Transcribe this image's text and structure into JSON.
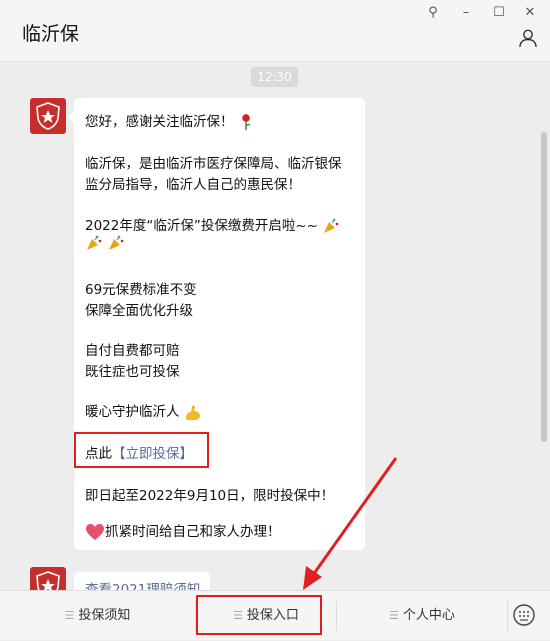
{
  "window": {
    "title": "临沂保"
  },
  "controls": {
    "pin": "⚲",
    "minimize": "–",
    "maximize": "☐",
    "close": "✕"
  },
  "chat": {
    "timestamp": "12:30",
    "message": {
      "lines": [
        "您好，感谢关注临沂保！",
        "临沂保，是由临沂市医疗保障局、临沂银保",
        "监分局指导，临沂人自己的惠民保！",
        "2022年度“临沂保”投保缴费开启啦~~",
        "69元保费标准不变",
        "保障全面优化升级",
        "自付自费都可赔",
        "既往症也可投保",
        "暖心守护临沂人",
        "即日起至2022年9月10日，限时投保中！",
        "抓紧时间给自己和家人办理！"
      ],
      "cta_prefix": "点此",
      "cta_link": "【立即投保】"
    },
    "second_message": "查看2021理赔须知"
  },
  "menu": {
    "items": [
      "投保须知",
      "投保入口",
      "个人中心"
    ]
  },
  "colors": {
    "accent_red": "#e02020",
    "link": "#576b95"
  }
}
